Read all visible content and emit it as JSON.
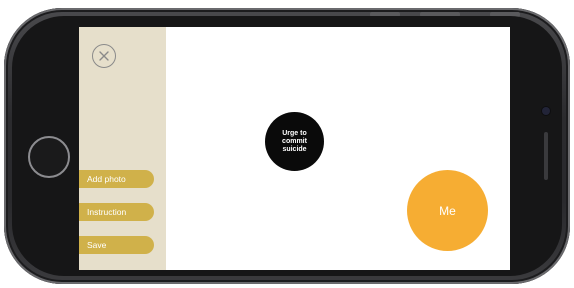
{
  "sidebar": {
    "close_icon": "close-circle-icon",
    "buttons": [
      {
        "label": "Add photo"
      },
      {
        "label": "Instruction"
      },
      {
        "label": "Save"
      }
    ]
  },
  "canvas": {
    "nodes": [
      {
        "label": "Urge to commit suicide",
        "color": "#0a0a0a"
      },
      {
        "label": "Me",
        "color": "#f6ad33"
      }
    ]
  },
  "colors": {
    "sidebar_bg": "#e6dfcb",
    "button_bg": "#d0b14a",
    "me_node": "#f6ad33",
    "phone_body": "#2b2b2e"
  }
}
